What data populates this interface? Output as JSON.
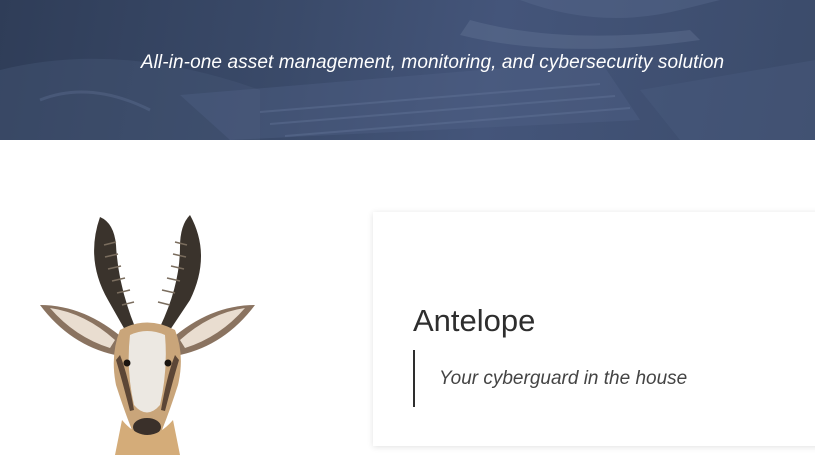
{
  "hero": {
    "tagline": "All-in-one asset management, monitoring, and cybersecurity solution"
  },
  "logo": {
    "icon": "antelope-head-icon"
  },
  "card": {
    "title": "Antelope",
    "quote": "Your cyberguard in the house"
  },
  "colors": {
    "hero_background": "#3a4a69",
    "hero_text": "#ffffff",
    "title_text": "#2e2e2e",
    "quote_border": "#2e2e2e"
  }
}
